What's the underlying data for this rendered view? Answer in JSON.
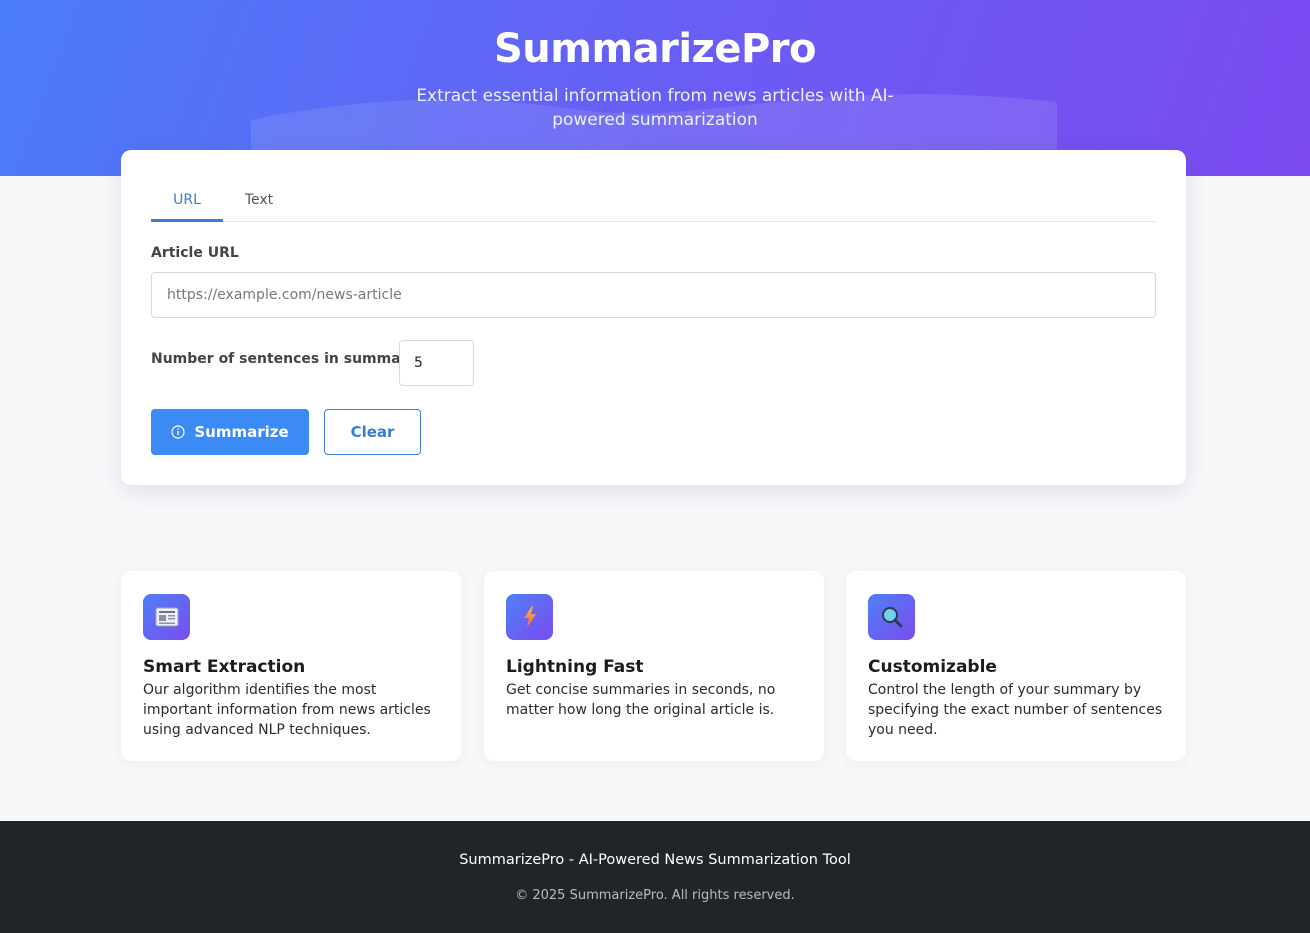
{
  "header": {
    "title": "SummarizePro",
    "subtitle": "Extract essential information from news articles with AI-powered summarization"
  },
  "form": {
    "tabs": [
      {
        "label": "URL",
        "active": true
      },
      {
        "label": "Text",
        "active": false
      }
    ],
    "url_label": "Article URL",
    "url_placeholder": "https://example.com/news-article",
    "url_value": "",
    "sentences_label": "Number of sentences in summary:",
    "sentences_value": "5",
    "summarize_label": "Summarize",
    "summarize_icon": "info-circle-icon",
    "clear_label": "Clear"
  },
  "features": [
    {
      "icon": "newspaper-icon",
      "title": "Smart Extraction",
      "description": "Our algorithm identifies the most important information from news articles using advanced NLP techniques."
    },
    {
      "icon": "lightning-icon",
      "title": "Lightning Fast",
      "description": "Get concise summaries in seconds, no matter how long the original article is."
    },
    {
      "icon": "magnifier-icon",
      "title": "Customizable",
      "description": "Control the length of your summary by specifying the exact number of sentences you need."
    }
  ],
  "footer": {
    "tagline": "SummarizePro - AI-Powered News Summarization Tool",
    "copyright": "© 2025 SummarizePro. All rights reserved."
  },
  "colors": {
    "accent": "#3b8af5",
    "tab_active": "#3a7bd5",
    "hero_start": "#4a7cfa",
    "hero_end": "#7a4aef",
    "footer_bg": "#212529"
  }
}
